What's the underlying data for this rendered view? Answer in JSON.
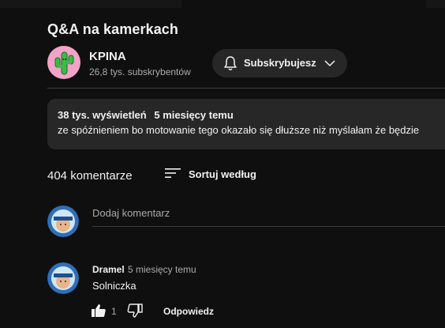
{
  "video": {
    "title": "Q&A na kamerkach"
  },
  "channel": {
    "name": "KPINA",
    "subscribers": "26,8 tys. subskrybentów",
    "subscribe_label": "Subskrybujesz"
  },
  "description": {
    "views": "38 tys. wyświetleń",
    "date": "5 miesięcy temu",
    "text": "ze spóźnieniem bo motowanie tego okazało się dłuższe niż myślałam że będzie"
  },
  "comments": {
    "count_label": "404 komentarze",
    "sort_label": "Sortuj według",
    "add_placeholder": "Dodaj komentarz",
    "items": [
      {
        "author": "Dramel",
        "time": "5 miesięcy temu",
        "text": "Solniczka",
        "likes": "1",
        "reply_label": "Odpowiedz"
      }
    ]
  },
  "colors": {
    "background": "#0f0f0f",
    "surface": "#272727",
    "text": "#f1f1f1",
    "muted": "#aaaaaa",
    "avatar_channel": "#f3a3c8",
    "avatar_user": "#2f6fb5"
  },
  "icons": {
    "bell": "bell-icon",
    "chevron": "chevron-down-icon",
    "sort": "sort-icon",
    "like": "thumbs-up-icon",
    "dislike": "thumbs-down-icon"
  }
}
